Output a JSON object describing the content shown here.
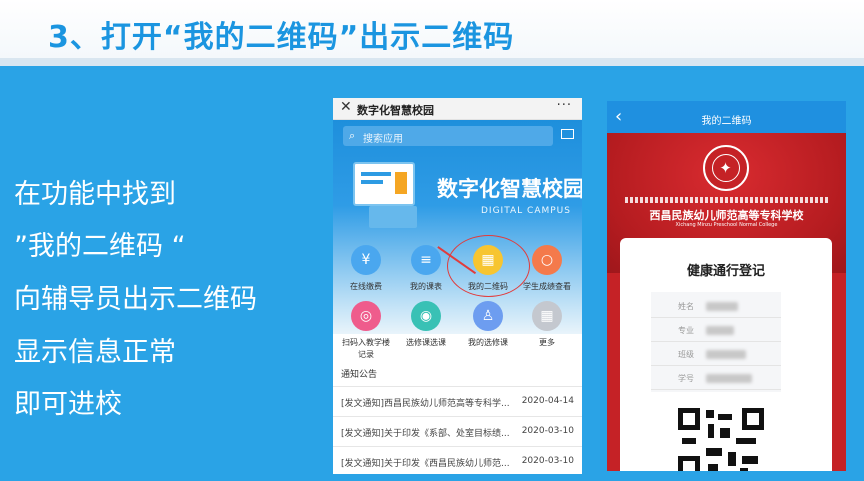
{
  "slide": {
    "title": "3、打开“我的二维码”出示二维码",
    "steps": [
      "在功能中找到",
      "”我的二维码 “",
      "向辅导员出示二维码",
      "显示信息正常",
      "即可进校"
    ]
  },
  "phone1": {
    "close_icon": "✕",
    "title": "数字化智慧校园",
    "more_icon": "···",
    "search_placeholder": "搜索应用",
    "banner_title": "数字化智慧校园",
    "banner_subtitle": "DIGITAL CAMPUS",
    "apps": [
      {
        "label": "在线缴费",
        "icon": "yen-icon",
        "glyph": "¥",
        "color": "#4aa7ef"
      },
      {
        "label": "我的课表",
        "icon": "document-icon",
        "glyph": "≡",
        "color": "#4aa7ef"
      },
      {
        "label": "我的二维码",
        "icon": "qr-icon",
        "glyph": "▦",
        "color": "#f7c531"
      },
      {
        "label": "学生成绩查看",
        "icon": "search-icon",
        "glyph": "○",
        "color": "#f47a4b"
      },
      {
        "label": "扫码入教学楼记录",
        "icon": "scan-icon",
        "glyph": "◎",
        "color": "#ef5c8c"
      },
      {
        "label": "选修课选课",
        "icon": "target-icon",
        "glyph": "◉",
        "color": "#39c1b5"
      },
      {
        "label": "我的选修课",
        "icon": "user-icon",
        "glyph": "♙",
        "color": "#6d9df0"
      },
      {
        "label": "更多",
        "icon": "grid-icon",
        "glyph": "▦",
        "color": "#c4c8cf"
      }
    ],
    "section_title": "通知公告",
    "news": [
      {
        "title": "[发文通知]西昌民族幼儿师范高等专科学...",
        "date": "2020-04-14"
      },
      {
        "title": "[发文通知]关于印发《系部、处室目标绩...",
        "date": "2020-03-10"
      },
      {
        "title": "[发文通知]关于印发《西昌民族幼儿师范...",
        "date": "2020-03-10"
      }
    ]
  },
  "phone2": {
    "back_icon": "‹",
    "title": "我的二维码",
    "school_name": "西昌民族幼儿师范高等专科学校",
    "school_name_en": "Xichang Minzu Preschool Normal College",
    "card_title": "健康通行登记",
    "fields": [
      "姓名",
      "专业",
      "班级",
      "学号"
    ]
  },
  "colors": {
    "background": "#2aa3e6",
    "title_blue": "#1b95e0",
    "phone2_red": "#c52226",
    "highlight_ring": "#e23b3b"
  }
}
